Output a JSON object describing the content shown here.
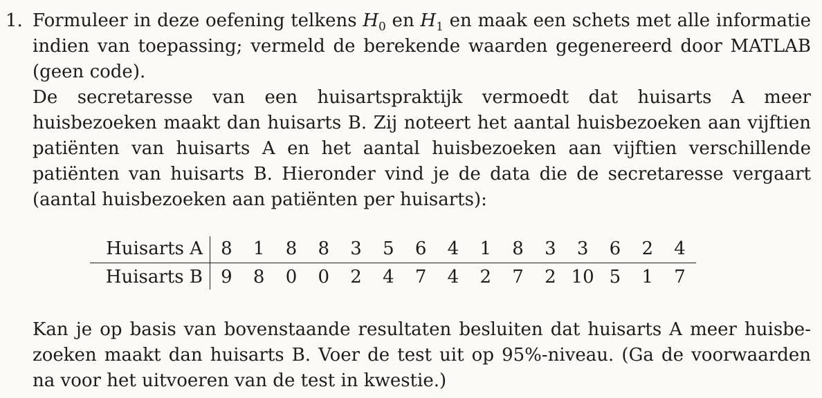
{
  "exercise": {
    "number": "1.",
    "instruction": {
      "part1": "Formuleer in deze oefening telkens ",
      "h0_letter": "H",
      "h0_sub": "0",
      "part2": " en ",
      "h1_letter": "H",
      "h1_sub": "1",
      "part3": " en maak een schets met alle informatie indien van toepassing; vermeld de berekende waarden gegenereerd door MATLAB (geen code)."
    },
    "scenario": "De secretaresse van een huisartspraktijk vermoedt dat huisarts A meer huisbezoeken maakt dan huisarts B. Zij noteert het aantal huisbezoeken aan vijftien patiënten van huisarts A en het aantal huisbezoeken aan vijftien verschillende patiënten van huisarts B. Hieronder vind je de data die de secretaresse vergaart (aantal huisbezoeken aan patiënten per huisarts):",
    "question": "Kan je op basis van bovenstaande resultaten besluiten dat huisarts A meer huisbe­zoeken maakt dan huisarts B. Voer de test uit op 95%-niveau. (Ga de voorwaarden na voor het uitvoeren van de test in kwestie.)"
  },
  "data_table": {
    "rows": [
      {
        "label": "Huisarts A",
        "values": [
          "8",
          "1",
          "8",
          "8",
          "3",
          "5",
          "6",
          "4",
          "1",
          "8",
          "3",
          "3",
          "6",
          "2",
          "4"
        ]
      },
      {
        "label": "Huisarts B",
        "values": [
          "9",
          "8",
          "0",
          "0",
          "2",
          "4",
          "7",
          "4",
          "2",
          "7",
          "2",
          "10",
          "5",
          "1",
          "7"
        ]
      }
    ]
  }
}
